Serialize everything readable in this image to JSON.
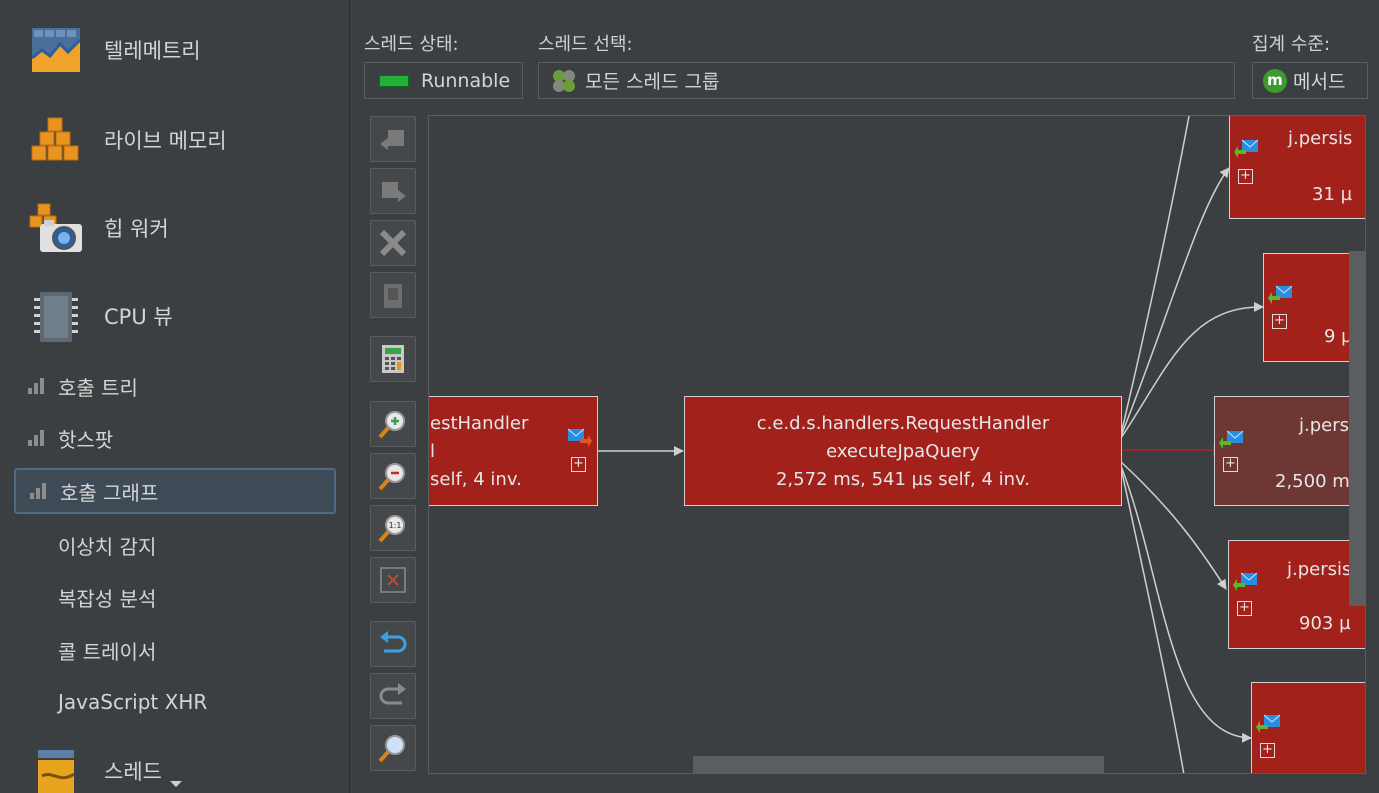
{
  "sidebar": {
    "big_items": [
      {
        "label": "텔레메트리",
        "icon": "telemetry-icon"
      },
      {
        "label": "라이브 메모리",
        "icon": "live-memory-icon"
      },
      {
        "label": "힙 워커",
        "icon": "heap-walker-icon"
      },
      {
        "label": "CPU 뷰",
        "icon": "cpu-icon"
      }
    ],
    "sub_items": [
      {
        "label": "호출 트리",
        "selected": false
      },
      {
        "label": "핫스팟",
        "selected": false
      },
      {
        "label": "호출 그래프",
        "selected": true
      }
    ],
    "plain_items": [
      "이상치 감지",
      "복잡성 분석",
      "콜 트레이서",
      "JavaScript XHR"
    ],
    "bottom_item": {
      "label": "스레드",
      "icon": "threads-icon"
    }
  },
  "controls": {
    "thread_state_label": "스레드 상태:",
    "thread_state_value": "Runnable",
    "thread_select_label": "스레드 선택:",
    "thread_select_value": "모든 스레드 그룹",
    "aggregation_label": "집계 수준:",
    "aggregation_value": "메서드"
  },
  "toolbar": [
    "back-icon",
    "forward-icon",
    "delete-icon",
    "trash-icon",
    "calculator-icon",
    "zoom-in-icon",
    "zoom-out-icon",
    "zoom-100-icon",
    "fit-icon",
    "undo-icon",
    "redo-icon",
    "find-icon"
  ],
  "graph": {
    "left_node": {
      "line1": "estHandler",
      "line2": "l",
      "line3": "self, 4 inv."
    },
    "center_node": {
      "line1": "c.e.d.s.handlers.RequestHandler",
      "line2": "executeJpaQuery",
      "line3": "2,572 ms, 541 µs self, 4 inv."
    },
    "right_nodes": [
      {
        "title": "j.persis",
        "value": "31 µ"
      },
      {
        "title": "",
        "value": "9 µ"
      },
      {
        "title": "j.pers",
        "value": "2,500 m"
      },
      {
        "title": "j.persis",
        "value": "903 µ"
      },
      {
        "title": "",
        "value": ""
      }
    ]
  },
  "colors": {
    "node_red": "#a3211b",
    "node_brown": "#6e3733",
    "hot_edge": "#b8231c",
    "edge": "#cfcfcf",
    "runnable_green": "#22b036"
  }
}
